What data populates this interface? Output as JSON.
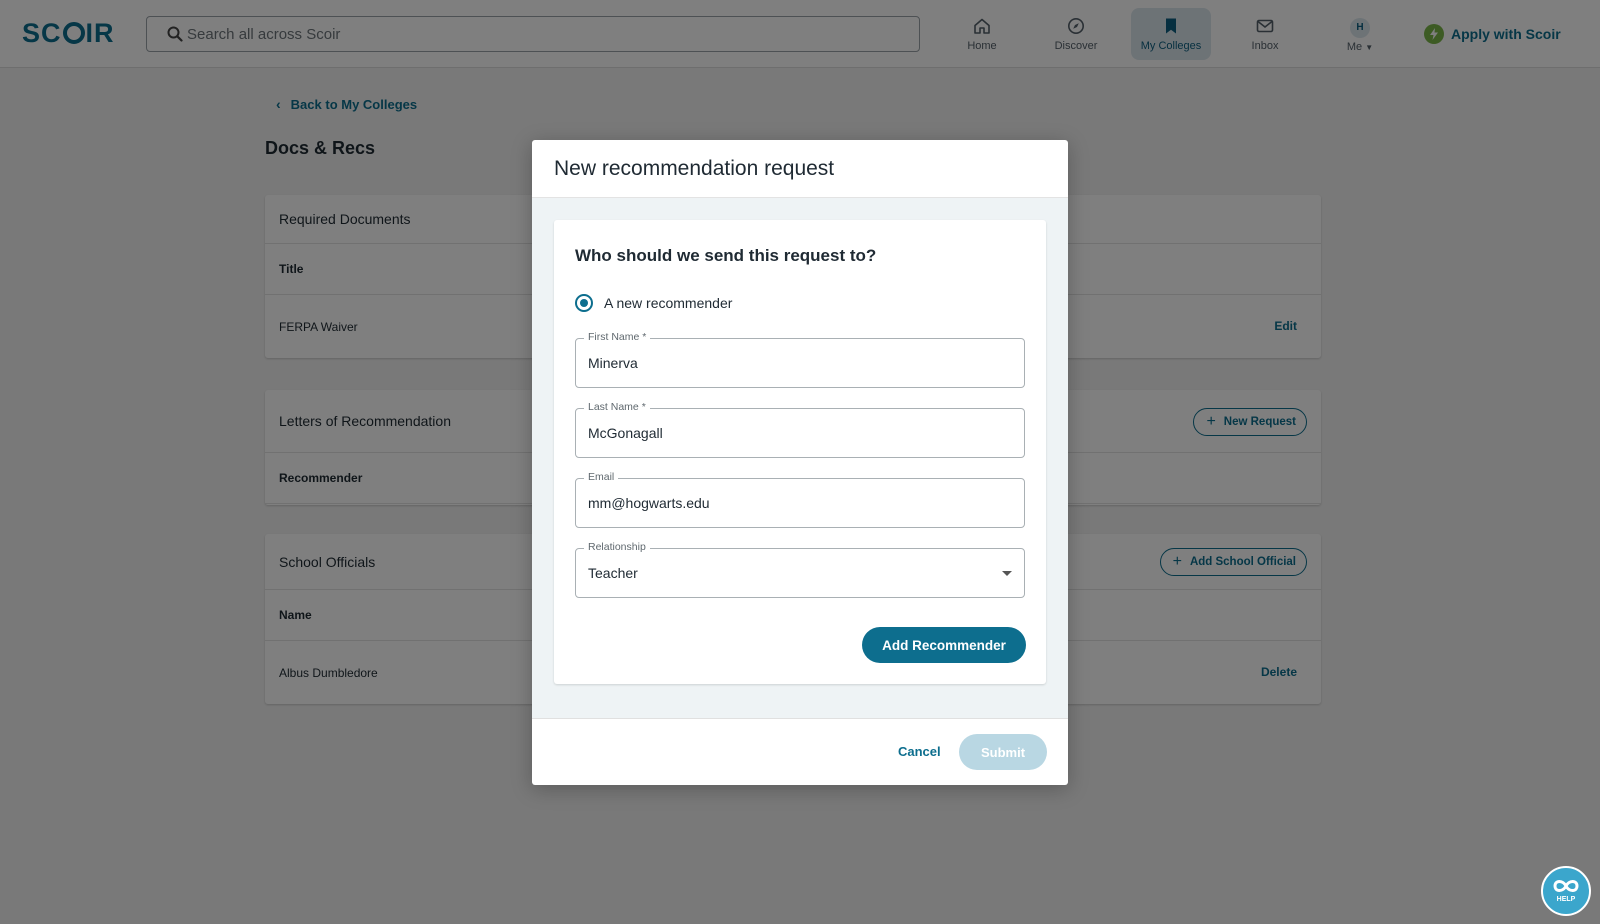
{
  "header": {
    "logo": "SCOIR",
    "search_placeholder": "Search all across Scoir",
    "nav": [
      {
        "label": "Home",
        "icon": "home-icon"
      },
      {
        "label": "Discover",
        "icon": "compass-icon"
      },
      {
        "label": "My Colleges",
        "icon": "bookmark-icon",
        "active": true
      },
      {
        "label": "Inbox",
        "icon": "mail-icon"
      },
      {
        "label": "Me",
        "icon": "avatar",
        "avatar_initial": "H"
      }
    ],
    "apply_label": "Apply with Scoir"
  },
  "page": {
    "back_label": "Back to My Colleges",
    "title": "Docs & Recs",
    "required_documents": {
      "title": "Required Documents",
      "column": "Title",
      "rows": [
        {
          "name": "FERPA Waiver",
          "action": "Edit"
        }
      ]
    },
    "letters": {
      "title": "Letters of Recommendation",
      "button": "New Request",
      "column": "Recommender"
    },
    "school_officials": {
      "title": "School Officials",
      "button": "Add School Official",
      "column": "Name",
      "rows": [
        {
          "name": "Albus Dumbledore",
          "action": "Delete"
        }
      ]
    }
  },
  "modal": {
    "title": "New recommendation request",
    "question": "Who should we send this request to?",
    "radio_label": "A new recommender",
    "fields": {
      "first_name": {
        "label": "First Name *",
        "value": "Minerva"
      },
      "last_name": {
        "label": "Last Name *",
        "value": "McGonagall"
      },
      "email": {
        "label": "Email",
        "value": "mm@hogwarts.edu"
      },
      "relationship": {
        "label": "Relationship",
        "value": "Teacher"
      }
    },
    "add_button": "Add Recommender",
    "cancel": "Cancel",
    "submit": "Submit"
  },
  "help": {
    "label": "HELP"
  },
  "colors": {
    "brand": "#0d6e8e",
    "accent_green": "#7ab648",
    "submit_disabled": "#b9d7e3",
    "help": "#3ba6cc"
  }
}
